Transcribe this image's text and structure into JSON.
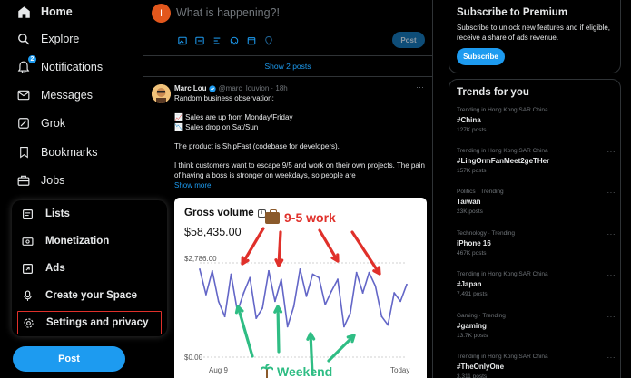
{
  "sidebar": {
    "nav": [
      {
        "label": "Home",
        "icon": "home-icon"
      },
      {
        "label": "Explore",
        "icon": "search-icon"
      },
      {
        "label": "Notifications",
        "icon": "bell-icon",
        "badge": "2"
      },
      {
        "label": "Messages",
        "icon": "envelope-icon"
      },
      {
        "label": "Grok",
        "icon": "grok-icon"
      },
      {
        "label": "Bookmarks",
        "icon": "bookmark-icon"
      },
      {
        "label": "Jobs",
        "icon": "briefcase-icon"
      }
    ],
    "more_menu": [
      {
        "label": "Lists",
        "icon": "list-icon"
      },
      {
        "label": "Monetization",
        "icon": "monetization-icon"
      },
      {
        "label": "Ads",
        "icon": "ads-icon"
      },
      {
        "label": "Create your Space",
        "icon": "microphone-icon"
      },
      {
        "label": "Settings and privacy",
        "icon": "gear-icon"
      }
    ],
    "post_label": "Post"
  },
  "composer": {
    "avatar_letter": "I",
    "placeholder": "What is happening?!",
    "post_label": "Post",
    "tools": [
      "image-icon",
      "gif-icon",
      "poll-icon",
      "emoji-icon",
      "schedule-icon",
      "location-icon"
    ]
  },
  "timeline": {
    "show_posts": "Show 2 posts"
  },
  "tweet": {
    "author_name": "Marc Lou",
    "author_handle": "@marc_louvion · 18h",
    "lines": [
      "Random business observation:",
      "📈 Sales are up from Monday/Friday",
      "📉 Sales drop on Sat/Sun",
      "The product is ShipFast (codebase for developers).",
      "I think customers want to escape 9/5 and work on their own projects. The pain of having a boss is stronger on weekdays, so people are"
    ],
    "show_more": "Show more",
    "chart_card": {
      "title": "Gross volume",
      "value": "$58,435.00",
      "annotation_work": "9-5 work",
      "annotation_weekend": "Weekend",
      "accent_work": "#e0302a",
      "accent_weekend": "#2fbd84"
    }
  },
  "chart_data": {
    "type": "line",
    "title": "Gross volume",
    "ylabel": "",
    "xlabel": "",
    "y_tick_labels": [
      "$2,786.00",
      "$0.00"
    ],
    "x_tick_labels": [
      "Aug 9",
      "Today"
    ],
    "ylim": [
      0,
      2786
    ],
    "series": [
      {
        "color": "#6366c7",
        "values": [
          2600,
          1850,
          2550,
          1650,
          1200,
          2450,
          1350,
          1900,
          2350,
          1150,
          1450,
          2550,
          1650,
          2300,
          900,
          1500,
          2600,
          1800,
          2450,
          2350,
          1550,
          1950,
          2300,
          900,
          1300,
          2500,
          1900,
          2500,
          2100,
          1200,
          950,
          1900,
          1650,
          2150
        ]
      }
    ]
  },
  "right": {
    "premium": {
      "title": "Subscribe to Premium",
      "description": "Subscribe to unlock new features and if eligible, receive a share of ads revenue.",
      "button": "Subscribe"
    },
    "trends_title": "Trends for you",
    "trends": [
      {
        "context": "Trending in Hong Kong SAR China",
        "name": "#China",
        "count": "127K posts"
      },
      {
        "context": "Trending in Hong Kong SAR China",
        "name": "#LingOrmFanMeet2geTHer",
        "count": "157K posts"
      },
      {
        "context": "Politics · Trending",
        "name": "Taiwan",
        "count": "23K posts"
      },
      {
        "context": "Technology · Trending",
        "name": "iPhone 16",
        "count": "467K posts"
      },
      {
        "context": "Trending in Hong Kong SAR China",
        "name": "#Japan",
        "count": "7,491 posts"
      },
      {
        "context": "Gaming · Trending",
        "name": "#gaming",
        "count": "13.7K posts"
      },
      {
        "context": "Trending in Hong Kong SAR China",
        "name": "#TheOnlyOne",
        "count": "3,311 posts"
      }
    ]
  }
}
